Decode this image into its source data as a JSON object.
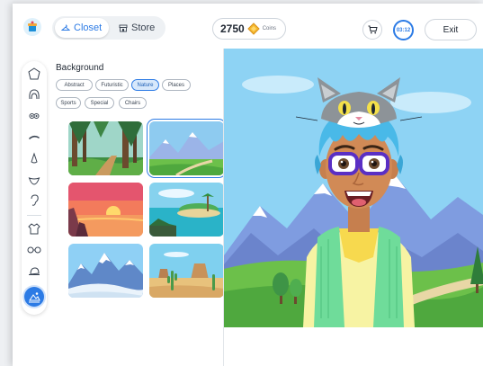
{
  "header": {
    "tabs": [
      {
        "label": "Closet",
        "icon": "hanger-icon",
        "active": true
      },
      {
        "label": "Store",
        "icon": "store-icon",
        "active": false
      }
    ],
    "coins": {
      "amount": "2750",
      "label": "Coins"
    },
    "timer": "03:12",
    "exit_label": "Exit"
  },
  "rail": {
    "items": [
      "head-shape-icon",
      "hair-icon",
      "eyes-icon",
      "eyebrows-icon",
      "nose-icon",
      "mouth-icon",
      "ear-icon",
      "outfit-icon",
      "glasses-icon",
      "hat-icon",
      "background-icon"
    ],
    "active": "background-icon"
  },
  "panel": {
    "title": "Background",
    "chips": [
      {
        "label": "Abstract",
        "active": false
      },
      {
        "label": "Futuristic",
        "active": false
      },
      {
        "label": "Nature",
        "active": true
      },
      {
        "label": "Places",
        "active": false
      },
      {
        "label": "Sports",
        "active": false
      },
      {
        "label": "Special",
        "active": false
      },
      {
        "label": "Chairs",
        "active": false
      }
    ],
    "backgrounds": [
      {
        "name": "forest",
        "selected": false
      },
      {
        "name": "mountain-meadow",
        "selected": true
      },
      {
        "name": "sunset-lake",
        "selected": false
      },
      {
        "name": "tropical-island",
        "selected": false
      },
      {
        "name": "snowy-peaks",
        "selected": false
      },
      {
        "name": "desert-cactus",
        "selected": false
      }
    ]
  },
  "colors": {
    "accent": "#2c7be5",
    "hair": "#49b9e8",
    "vest": "#6fdc9a",
    "glasses": "#5a2fc4"
  }
}
